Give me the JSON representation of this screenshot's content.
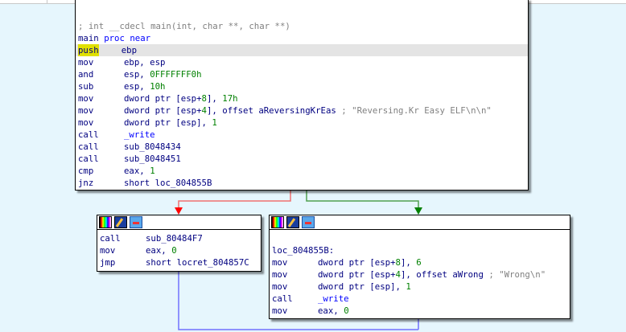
{
  "main_block": {
    "lines": [
      [
        [
          "cmt",
          "; int __cdecl main(int, char **, char **)"
        ]
      ],
      [
        [
          "lbl",
          "main "
        ],
        [
          "fn",
          "proc near"
        ]
      ],
      [
        [
          "mn",
          "push"
        ],
        [
          "op",
          "ebp"
        ]
      ],
      [
        [
          "mn",
          "mov"
        ],
        [
          "op",
          "ebp, esp"
        ]
      ],
      [
        [
          "mn",
          "and"
        ],
        [
          "op",
          "esp, "
        ],
        [
          "num",
          "0FFFFFFF0h"
        ]
      ],
      [
        [
          "mn",
          "sub"
        ],
        [
          "op",
          "esp, "
        ],
        [
          "num",
          "10h"
        ]
      ],
      [
        [
          "mn",
          "mov"
        ],
        [
          "op",
          "dword ptr [esp+"
        ],
        [
          "num",
          "8"
        ],
        [
          "op",
          "], "
        ],
        [
          "num",
          "17h"
        ]
      ],
      [
        [
          "mn",
          "mov"
        ],
        [
          "op",
          "dword ptr [esp+"
        ],
        [
          "num",
          "4"
        ],
        [
          "op",
          "], offset aReversingKrEas "
        ],
        [
          "cmt",
          "; \"Reversing.Kr Easy ELF\\n\\n\""
        ]
      ],
      [
        [
          "mn",
          "mov"
        ],
        [
          "op",
          "dword ptr [esp], "
        ],
        [
          "num",
          "1"
        ]
      ],
      [
        [
          "mn",
          "call"
        ],
        [
          "fn",
          "_write"
        ]
      ],
      [
        [
          "mn",
          "call"
        ],
        [
          "op",
          "sub_8048434"
        ]
      ],
      [
        [
          "mn",
          "call"
        ],
        [
          "op",
          "sub_8048451"
        ]
      ],
      [
        [
          "mn",
          "cmp"
        ],
        [
          "op",
          "eax, "
        ],
        [
          "num",
          "1"
        ]
      ],
      [
        [
          "mn",
          "jnz"
        ],
        [
          "op",
          "short loc_804855B"
        ]
      ]
    ]
  },
  "left_block": {
    "lines": [
      [
        [
          "mn",
          "call"
        ],
        [
          "op",
          "sub_80484F7"
        ]
      ],
      [
        [
          "mn",
          "mov"
        ],
        [
          "op",
          "eax, "
        ],
        [
          "num",
          "0"
        ]
      ],
      [
        [
          "mn",
          "jmp"
        ],
        [
          "op",
          "short locret_804857C"
        ]
      ]
    ]
  },
  "right_block": {
    "lines": [
      [],
      [
        [
          "lbl",
          "loc_804855B:"
        ]
      ],
      [
        [
          "mn",
          "mov"
        ],
        [
          "op",
          "dword ptr [esp+"
        ],
        [
          "num",
          "8"
        ],
        [
          "op",
          "], "
        ],
        [
          "num",
          "6"
        ]
      ],
      [
        [
          "mn",
          "mov"
        ],
        [
          "op",
          "dword ptr [esp+"
        ],
        [
          "num",
          "4"
        ],
        [
          "op",
          "], offset aWrong "
        ],
        [
          "cmt",
          "; \"Wrong\\n\""
        ]
      ],
      [
        [
          "mn",
          "mov"
        ],
        [
          "op",
          "dword ptr [esp], "
        ],
        [
          "num",
          "1"
        ]
      ],
      [
        [
          "mn",
          "call"
        ],
        [
          "fn",
          "_write"
        ]
      ],
      [
        [
          "mn",
          "mov"
        ],
        [
          "op",
          "eax, "
        ],
        [
          "num",
          "0"
        ]
      ]
    ]
  },
  "colors": {
    "false_edge": "#ff0000",
    "true_edge": "#008000",
    "flow_edge": "#7070ff",
    "highlight": "#e0e000"
  }
}
